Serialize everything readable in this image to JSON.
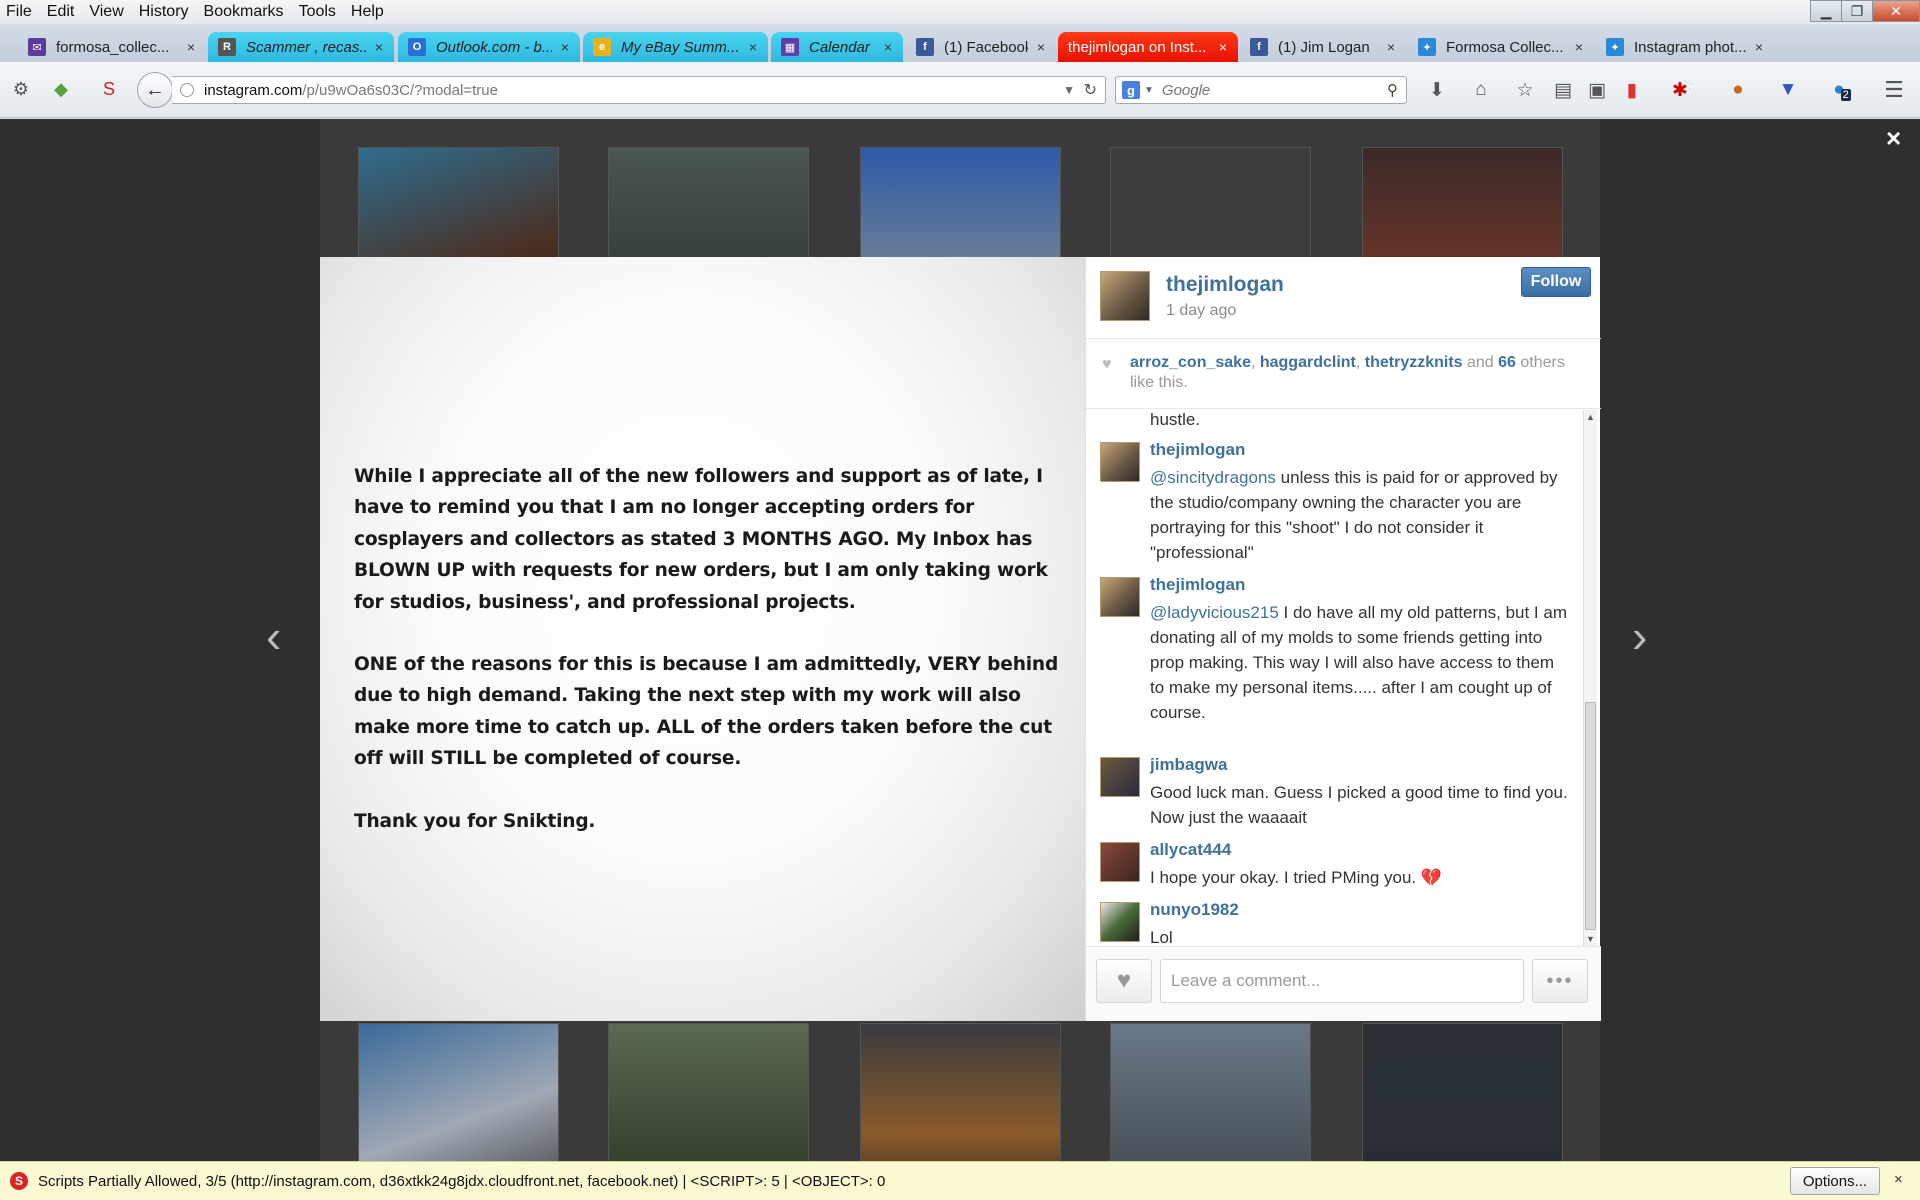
{
  "menubar": {
    "items": [
      "File",
      "Edit",
      "View",
      "History",
      "Bookmarks",
      "Tools",
      "Help"
    ]
  },
  "window_controls": {
    "minimize": "▁",
    "maximize": "❐",
    "close": "✕"
  },
  "tabs": [
    {
      "title": "formosa_collec...",
      "icon": "mail-icon",
      "icon_color": "#5c3a9e",
      "style": "plain"
    },
    {
      "title": "Scammer , recas...",
      "icon": "rpf-icon",
      "icon_color": "#555555",
      "style": "cyan"
    },
    {
      "title": "Outlook.com - b...",
      "icon": "outlook-icon",
      "icon_color": "#2a6fd6",
      "style": "cyan"
    },
    {
      "title": "My eBay Summ...",
      "icon": "ebay-icon",
      "icon_color": "#e8b21c",
      "style": "cyan"
    },
    {
      "title": "Calendar",
      "icon": "calendar-icon",
      "icon_color": "#5b3fa6",
      "style": "cyan"
    },
    {
      "title": "(1) Facebook",
      "icon": "facebook-icon",
      "icon_color": "#3b5998",
      "style": "plain"
    },
    {
      "title": "thejimlogan on Inst...",
      "icon": "",
      "icon_color": "",
      "style": "active"
    },
    {
      "title": "(1) Jim Logan",
      "icon": "facebook-icon",
      "icon_color": "#3b5998",
      "style": "plain"
    },
    {
      "title": "Formosa Collec...",
      "icon": "formosa-icon",
      "icon_color": "#2b8ad8",
      "style": "plain"
    },
    {
      "title": "Instagram phot...",
      "icon": "formosa-icon",
      "icon_color": "#2b8ad8",
      "style": "plain"
    }
  ],
  "new_tab": "+",
  "urlbar": {
    "host": "instagram.com",
    "path": "/p/u9wOa6s03C/?modal=true"
  },
  "searchbar": {
    "engine_letter": "g",
    "placeholder": "Google"
  },
  "toolbar_badge": "2",
  "modal": {
    "close": "×",
    "prev_arrow": "‹",
    "next_arrow": "›",
    "photo_paragraphs": [
      "While I appreciate all of the new followers and support as of late, I have to remind you that I am no longer accepting orders for cosplayers and collectors as stated 3 MONTHS AGO. My Inbox has BLOWN UP with requests for new orders, but I am only taking work for studios, business', and professional projects.",
      "ONE of the reasons for this is because I am admittedly, VERY behind due to high demand. Taking the next step with my work will also make more time to catch up. ALL of the orders taken before the cut off will STILL be completed of course.",
      "Thank you for Snikting."
    ],
    "header": {
      "username": "thejimlogan",
      "time": "1 day ago",
      "follow_label": "Follow"
    },
    "likes": {
      "users": [
        "arroz_con_sake",
        "haggardclint",
        "thetryzzknits"
      ],
      "sep1": ", ",
      "sep2": ", ",
      "and": " and ",
      "count": "66",
      "suffix": " others like this."
    },
    "comments_continued": "hustle.",
    "comments": [
      {
        "user": "thejimlogan",
        "mention": "@sincitydragons",
        "text": " unless this is paid for or approved by the studio/company owning the character you are portraying for this \"shoot\" I do not consider it \"professional\""
      },
      {
        "user": "thejimlogan",
        "mention": "@ladyvicious215",
        "text": " I do have all my old patterns, but I am donating all of my molds to some friends getting into prop making. This way I will also have access to them to make my personal items..... after I am cought up of course."
      },
      {
        "user": "jimbagwa",
        "mention": "",
        "text": "Good luck man. Guess I picked a good time to find you. Now just the waaaait"
      },
      {
        "user": "allycat444",
        "mention": "",
        "text": "I hope your okay. I tried PMing you. 💔"
      },
      {
        "user": "nunyo1982",
        "mention": "",
        "text": "Lol"
      }
    ],
    "comment_placeholder": "Leave a comment...",
    "more_label": "•••"
  },
  "statusbar": {
    "text": "Scripts Partially Allowed, 3/5 (http://instagram.com, d36xtkk24g8jdx.cloudfront.net, facebook.net) | <SCRIPT>: 5 | <OBJECT>: 0",
    "options_label": "Options...",
    "close": "×"
  },
  "colors": {
    "instagram_blue": "#3f729b",
    "active_tab": "#ff2a0a",
    "cyan_tab": "#3cc6e8"
  }
}
